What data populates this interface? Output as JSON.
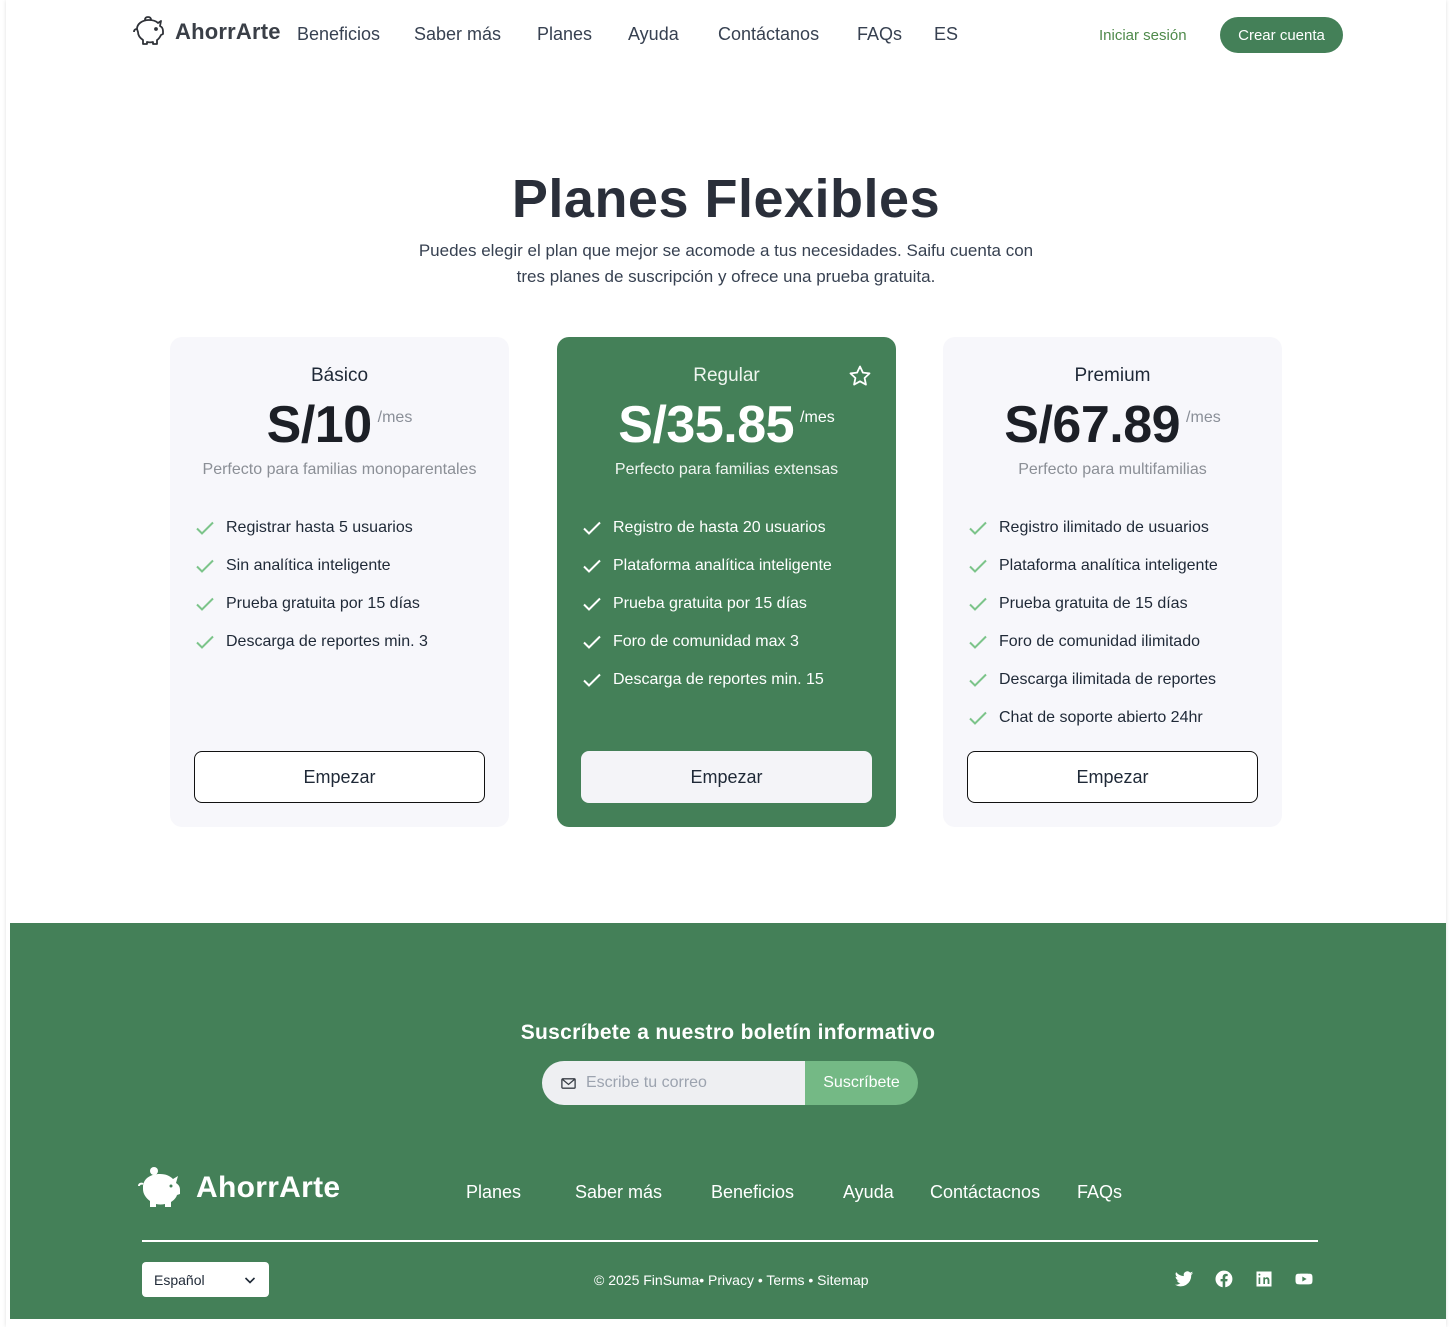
{
  "nav": {
    "brand": "AhorrArte",
    "links": [
      "Beneficios",
      "Saber más",
      "Planes",
      "Ayuda",
      "Contáctanos",
      "FAQs",
      "ES"
    ],
    "login": "Iniciar sesión",
    "signup": "Crear cuenta"
  },
  "hero": {
    "title": "Planes Flexibles",
    "subtitle": "Puedes elegir el plan que mejor se acomode a tus necesidades. Saifu cuenta con tres planes de suscripción y ofrece una prueba gratuita."
  },
  "plans": [
    {
      "name": "Básico",
      "price": "S/10",
      "period": "/mes",
      "description": "Perfecto para familias monoparentales",
      "features": [
        "Registrar hasta 5 usuarios",
        "Sin analítica inteligente",
        "Prueba gratuita por 15 días",
        "Descarga de reportes min. 3"
      ],
      "cta": "Empezar"
    },
    {
      "name": "Regular",
      "price": "S/35.85",
      "period": "/mes",
      "description": "Perfecto para familias extensas",
      "features": [
        "Registro de hasta 20 usuarios",
        "Plataforma analítica inteligente",
        "Prueba gratuita por 15 días",
        "Foro de comunidad max 3",
        "Descarga de reportes min. 15"
      ],
      "cta": "Empezar",
      "featured": true
    },
    {
      "name": "Premium",
      "price": "S/67.89",
      "period": "/mes",
      "description": "Perfecto para multifamilias",
      "features": [
        "Registro ilimitado de usuarios",
        "Plataforma analítica inteligente",
        "Prueba gratuita de 15 días",
        "Foro de comunidad ilimitado",
        "Descarga ilimitada de reportes",
        "Chat de soporte abierto 24hr"
      ],
      "cta": "Empezar"
    }
  ],
  "newsletter": {
    "title": "Suscríbete a nuestro boletín informativo",
    "placeholder": "Escribe tu correo",
    "button": "Suscríbete"
  },
  "footer": {
    "brand": "AhorrArte",
    "links": [
      "Planes",
      "Saber más",
      "Beneficios",
      "Ayuda",
      "Contáctacnos",
      "FAQs"
    ],
    "language": "Español",
    "copyright": "© 2025 FinSuma• Privacy • Terms • Sitemap",
    "socials": [
      "twitter-icon",
      "facebook-icon",
      "linkedin-icon",
      "youtube-icon"
    ]
  },
  "colors": {
    "brand_green": "#448058",
    "accent_light_green": "#74b985",
    "check_green": "#7cc48a"
  }
}
